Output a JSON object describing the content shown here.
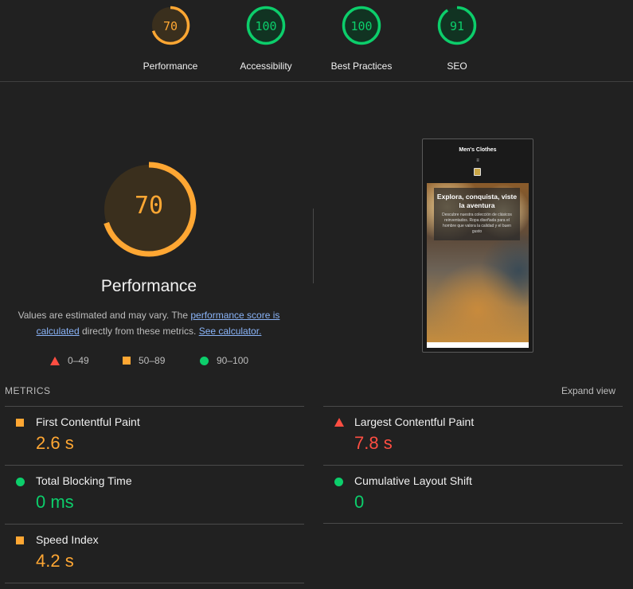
{
  "scores": [
    {
      "label": "Performance",
      "value": "70",
      "score": 70,
      "color": "#ffa733",
      "bg": "#3a2f1d"
    },
    {
      "label": "Accessibility",
      "value": "100",
      "score": 100,
      "color": "#0cce6b",
      "bg": "#113322"
    },
    {
      "label": "Best Practices",
      "value": "100",
      "score": 100,
      "color": "#0cce6b",
      "bg": "#113322"
    },
    {
      "label": "SEO",
      "value": "91",
      "score": 91,
      "color": "#0cce6b",
      "bg": "#113322"
    }
  ],
  "performance": {
    "score_text": "70",
    "score": 70,
    "title": "Performance",
    "desc_prefix": "Values are estimated and may vary. The ",
    "desc_link1": "performance score is calculated",
    "desc_middle": " directly from these metrics. ",
    "desc_link2": "See calculator."
  },
  "legend": {
    "fail": "0–49",
    "average": "50–89",
    "pass": "90–100"
  },
  "screenshot": {
    "site_title": "Men's Clothes",
    "menu_glyph": "≡",
    "hero_heading": "Explora, conquista, viste la aventura",
    "hero_text": "Descubre nuestra colección de clásicos reinventados. Ropa diseñada para el hombre que valora la calidad y el buen gusto"
  },
  "metrics": {
    "heading": "METRICS",
    "expand_label": "Expand view",
    "items": [
      {
        "name": "First Contentful Paint",
        "value": "2.6 s",
        "status": "average"
      },
      {
        "name": "Largest Contentful Paint",
        "value": "7.8 s",
        "status": "fail"
      },
      {
        "name": "Total Blocking Time",
        "value": "0 ms",
        "status": "pass"
      },
      {
        "name": "Cumulative Layout Shift",
        "value": "0",
        "status": "pass"
      },
      {
        "name": "Speed Index",
        "value": "4.2 s",
        "status": "average"
      }
    ]
  },
  "colors": {
    "pass": "#0cce6b",
    "average": "#ffa733",
    "fail": "#ff4e42"
  }
}
